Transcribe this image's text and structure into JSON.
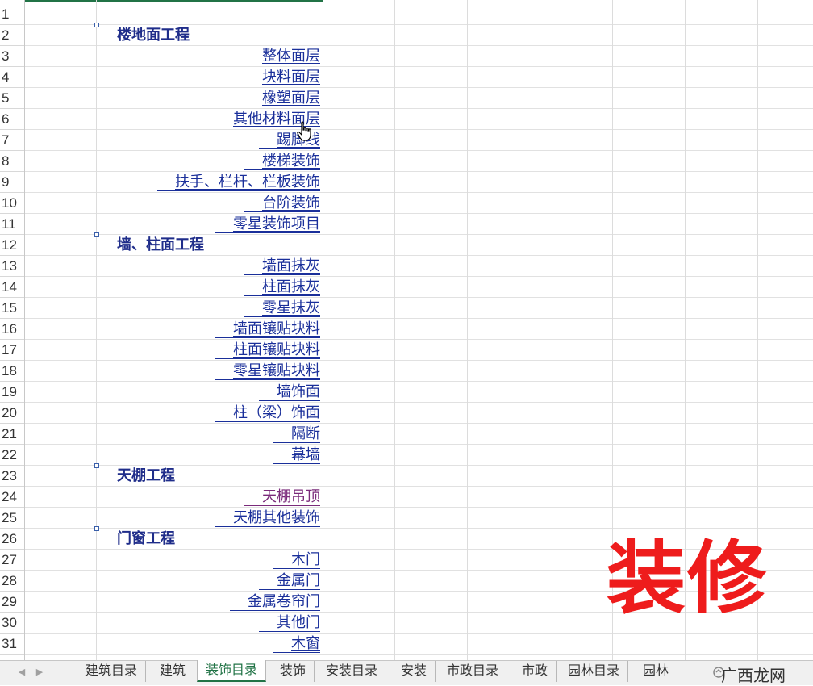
{
  "rows": [
    "1",
    "2",
    "3",
    "4",
    "5",
    "6",
    "7",
    "8",
    "9",
    "10",
    "11",
    "12",
    "13",
    "14",
    "15",
    "16",
    "17",
    "18",
    "19",
    "20",
    "21",
    "22",
    "23",
    "24",
    "25",
    "26",
    "27",
    "28",
    "29",
    "30",
    "31"
  ],
  "cells": [
    {
      "row": 2,
      "kind": "head",
      "text": "楼地面工程"
    },
    {
      "row": 3,
      "kind": "item",
      "text": "整体面层"
    },
    {
      "row": 4,
      "kind": "item",
      "text": "块料面层"
    },
    {
      "row": 5,
      "kind": "item",
      "text": "橡塑面层"
    },
    {
      "row": 6,
      "kind": "item",
      "text": "其他材料面层"
    },
    {
      "row": 7,
      "kind": "item",
      "text": "踢脚线"
    },
    {
      "row": 8,
      "kind": "item",
      "text": "楼梯装饰"
    },
    {
      "row": 9,
      "kind": "item",
      "text": "扶手、栏杆、栏板装饰"
    },
    {
      "row": 10,
      "kind": "item",
      "text": "台阶装饰"
    },
    {
      "row": 11,
      "kind": "item",
      "text": "零星装饰项目"
    },
    {
      "row": 12,
      "kind": "head",
      "text": "墙、柱面工程"
    },
    {
      "row": 13,
      "kind": "item",
      "text": "墙面抹灰"
    },
    {
      "row": 14,
      "kind": "item",
      "text": "柱面抹灰"
    },
    {
      "row": 15,
      "kind": "item",
      "text": "零星抹灰"
    },
    {
      "row": 16,
      "kind": "item",
      "text": "墙面镶贴块料"
    },
    {
      "row": 17,
      "kind": "item",
      "text": "柱面镶贴块料"
    },
    {
      "row": 18,
      "kind": "item",
      "text": "零星镶贴块料"
    },
    {
      "row": 19,
      "kind": "item",
      "text": "墙饰面"
    },
    {
      "row": 20,
      "kind": "item",
      "text": "柱（梁）饰面"
    },
    {
      "row": 21,
      "kind": "item",
      "text": "隔断"
    },
    {
      "row": 22,
      "kind": "item",
      "text": "幕墙"
    },
    {
      "row": 23,
      "kind": "head",
      "text": "天棚工程"
    },
    {
      "row": 24,
      "kind": "item",
      "text": "天棚吊顶",
      "visited": true
    },
    {
      "row": 25,
      "kind": "item",
      "text": "天棚其他装饰"
    },
    {
      "row": 26,
      "kind": "head",
      "text": "门窗工程"
    },
    {
      "row": 27,
      "kind": "item",
      "text": "木门"
    },
    {
      "row": 28,
      "kind": "item",
      "text": "金属门"
    },
    {
      "row": 29,
      "kind": "item",
      "text": "金属卷帘门"
    },
    {
      "row": 30,
      "kind": "item",
      "text": "其他门"
    },
    {
      "row": 31,
      "kind": "item",
      "text": "木窗"
    }
  ],
  "watermark": "装修",
  "tabs": [
    {
      "label": "建筑目录",
      "active": false
    },
    {
      "label": "建筑",
      "active": false
    },
    {
      "label": "装饰目录",
      "active": true
    },
    {
      "label": "装饰",
      "active": false
    },
    {
      "label": "安装目录",
      "active": false
    },
    {
      "label": "安装",
      "active": false
    },
    {
      "label": "市政目录",
      "active": false
    },
    {
      "label": "市政",
      "active": false
    },
    {
      "label": "园林目录",
      "active": false
    },
    {
      "label": "园林",
      "active": false
    }
  ],
  "brand": "广西龙网",
  "colors": {
    "link": "#1a2f9a",
    "visited": "#7a2a7a",
    "accent": "#217346",
    "watermark": "#ee1c1c"
  }
}
